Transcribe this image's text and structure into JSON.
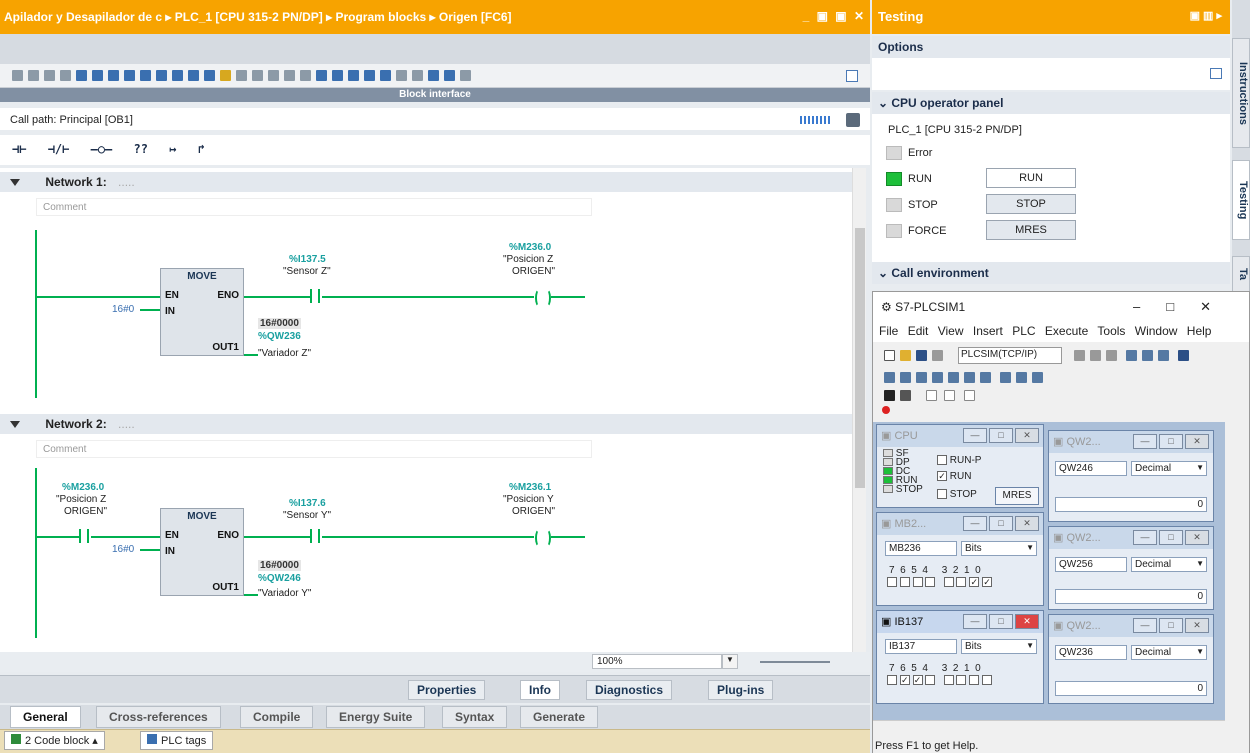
{
  "editor": {
    "title": "Apilador y Desapilador de c ▸ PLC_1 [CPU 315-2 PN/DP] ▸ Program blocks ▸ Origen [FC6]",
    "block_interface": "Block interface",
    "call_path": "Call path: Principal [OB1]",
    "ladder_tools": [
      "⊣⊢",
      "⊣/⊢",
      "–○–",
      "??",
      "↦",
      "↱"
    ],
    "networks": [
      {
        "title": "Network 1:",
        "comment": "Comment",
        "move_label": "MOVE",
        "en": "EN",
        "eno": "ENO",
        "in_pin": "IN",
        "out_pin": "OUT1",
        "in_value": "16#0",
        "contact_addr": "%I137.5",
        "contact_name": "\"Sensor Z\"",
        "coil_addr": "%M236.0",
        "coil_name1": "\"Posicion Z",
        "coil_name2": "ORIGEN\"",
        "out_value": "16#0000",
        "out_addr": "%QW236",
        "out_name": "\"Variador Z\""
      },
      {
        "title": "Network 2:",
        "comment": "Comment",
        "left_addr": "%M236.0",
        "left_name1": "\"Posicion Z",
        "left_name2": "ORIGEN\"",
        "move_label": "MOVE",
        "en": "EN",
        "eno": "ENO",
        "in_pin": "IN",
        "out_pin": "OUT1",
        "in_value": "16#0",
        "contact_addr": "%I137.6",
        "contact_name": "\"Sensor Y\"",
        "coil_addr": "%M236.1",
        "coil_name1": "\"Posicion Y",
        "coil_name2": "ORIGEN\"",
        "out_value": "16#0000",
        "out_addr": "%QW246",
        "out_name": "\"Variador Y\""
      }
    ],
    "zoom": "100%",
    "inspector_tabs": [
      "Properties",
      "Info",
      "Diagnostics",
      "Plug-ins"
    ],
    "bottom_tabs": [
      "General",
      "Cross-references",
      "Compile",
      "Energy Suite",
      "Syntax",
      "Generate"
    ],
    "taskbar": [
      "2 Code block",
      "PLC tags"
    ]
  },
  "testing": {
    "title": "Testing",
    "options": "Options",
    "cpu_panel_title": "CPU operator panel",
    "cpu_name": "PLC_1 [CPU 315-2 PN/DP]",
    "leds": [
      {
        "label": "Error",
        "on": false
      },
      {
        "label": "RUN",
        "on": true
      },
      {
        "label": "STOP",
        "on": false
      },
      {
        "label": "FORCE",
        "on": false
      }
    ],
    "buttons": [
      "RUN",
      "STOP",
      "MRES"
    ],
    "call_env": "Call environment",
    "side_tabs": [
      "Instructions",
      "Testing",
      "Ta"
    ]
  },
  "plcsim": {
    "title": "S7-PLCSIM1",
    "menu": [
      "File",
      "Edit",
      "View",
      "Insert",
      "PLC",
      "Execute",
      "Tools",
      "Window",
      "Help"
    ],
    "combo": "PLCSIM(TCP/IP)",
    "cpu": {
      "title": "CPU",
      "leds": [
        "SF",
        "DP",
        "DC",
        "RUN",
        "STOP"
      ],
      "run_p": "RUN-P",
      "run": "RUN",
      "stop": "STOP",
      "mres": "MRES"
    },
    "mb": {
      "title": "MB2...",
      "addr": "MB236",
      "format": "Bits",
      "bits": "7  6  5  4     3  2  1  0"
    },
    "ib": {
      "title": "IB137",
      "addr": "IB137",
      "format": "Bits",
      "bits": "7  6  5  4     3  2  1  0"
    },
    "qw1": {
      "title": "QW2...",
      "addr": "QW246",
      "format": "Decimal",
      "value": "0"
    },
    "qw2": {
      "title": "QW2...",
      "addr": "QW256",
      "format": "Decimal",
      "value": "0"
    },
    "qw3": {
      "title": "QW2...",
      "addr": "QW236",
      "format": "Decimal",
      "value": "0"
    },
    "status": "Press F1 to get Help."
  }
}
